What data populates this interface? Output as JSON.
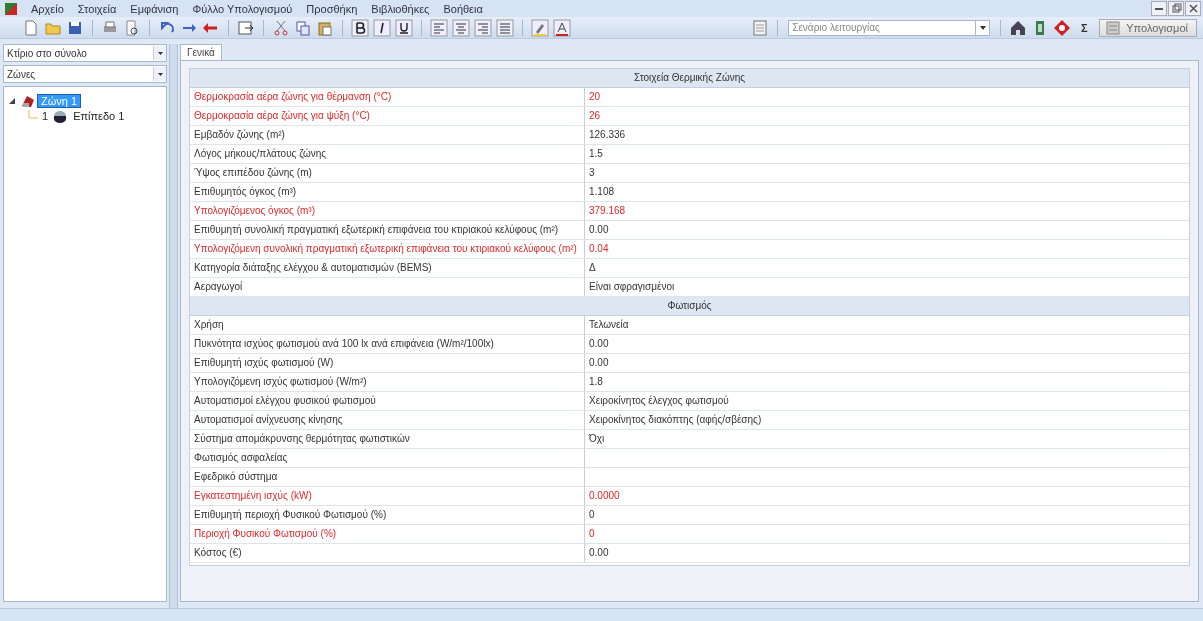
{
  "menu": [
    "Αρχείο",
    "Στοιχεία",
    "Εμφάνιση",
    "Φύλλο Υπολογισμού",
    "Προσθήκη",
    "Βιβλιοθήκες",
    "Βοήθεια"
  ],
  "toolbar": {
    "scenario": {
      "placeholder": "Σενάριο λειτουργίας"
    },
    "sum_symbol": "Σ",
    "calculate": "Υπολογισμοί"
  },
  "sidebar": {
    "building_select": "Κτίριο στο σύνολο",
    "zone_select": "Ζώνες",
    "tree": [
      {
        "label": "Ζώνη 1",
        "selected": true,
        "expanded": true,
        "children": [
          {
            "number": "1",
            "label": "Επίπεδο 1",
            "selected": false
          }
        ]
      }
    ]
  },
  "tabs": [
    {
      "label": "Γενικά",
      "selected": true
    }
  ],
  "sections": [
    {
      "title": "Στοιχεία Θερμικής Ζώνης",
      "rows": [
        {
          "label": "Θερμοκρασία αέρα ζώνης για θέρμανση (°C)",
          "value": "20",
          "highlighted": true
        },
        {
          "label": "Θερμοκρασία αέρα ζώνης για ψύξη (°C)",
          "value": "26",
          "highlighted": true
        },
        {
          "label": "Εμβαδόν ζώνης (m²)",
          "value": "126.336",
          "highlighted": false
        },
        {
          "label": "Λόγος μήκους/πλάτους ζώνης",
          "value": "1.5",
          "highlighted": false
        },
        {
          "label": "Ύψος επιπέδου ζώνης (m)",
          "value": "3",
          "highlighted": false
        },
        {
          "label": "Επιθυμητός όγκος (m³)",
          "value": "1.108",
          "highlighted": false
        },
        {
          "label": "Υπολογιζόμενος όγκος (m³)",
          "value": "379.168",
          "highlighted": true
        },
        {
          "label": "Επιθυμητή συνολική πραγματική εξωτερική επιφάνεια του κτιριακού κελύφους (m²)",
          "value": "0.00",
          "highlighted": false
        },
        {
          "label": "Υπολογιζόμενη συνολική πραγματική εξωτερική επιφάνεια του κτιριακού κελύφους (m²)",
          "value": "0.04",
          "highlighted": true
        },
        {
          "label": "Κατηγορία διάταξης ελέγχου & αυτοματισμών (BEMS)",
          "value": "Δ",
          "highlighted": false
        },
        {
          "label": "Αεραγωγοί",
          "value": "Είναι σφραγισμένοι",
          "highlighted": false
        }
      ]
    },
    {
      "title": "Φωτισμός",
      "rows": [
        {
          "label": "Χρήση",
          "value": "Τελωνεία",
          "highlighted": false
        },
        {
          "label": "Πυκνότητα ισχύος φωτισμού ανά 100 lx ανά επιφάνεια (W/m²/100lx)",
          "value": "0.00",
          "highlighted": false
        },
        {
          "label": "Επιθυμητή ισχύς φωτισμού (W)",
          "value": "0.00",
          "highlighted": false
        },
        {
          "label": "Υπολογιζόμενη ισχύς φωτισμού (W/m²)",
          "value": "1.8",
          "highlighted": false
        },
        {
          "label": "Αυτοματισμοί ελέγχου φυσικού φωτισμού",
          "value": "Χειροκίνητος έλεγχος φωτισμού",
          "highlighted": false
        },
        {
          "label": "Αυτοματισμοί ανίχνευσης κίνησης",
          "value": "Χειροκίνητος διακόπτης (αφής/σβέσης)",
          "highlighted": false
        },
        {
          "label": "Σύστημα απομάκρυνσης θερμότητας φωτιστικών",
          "value": "Όχι",
          "highlighted": false
        },
        {
          "label": "Φωτισμός ασφαλείας",
          "highlighted": false
        },
        {
          "label": "Εφεδρικό σύστημα",
          "highlighted": false
        },
        {
          "label": "Εγκατεστημένη ισχύς (kW)",
          "value": "0.0000",
          "highlighted": true
        },
        {
          "label": "Επιθυμητή περιοχή Φυσικού Φωτισμού (%)",
          "value": "0",
          "highlighted": false
        },
        {
          "label": "Περιοχή Φυσικού Φωτισμού (%)",
          "value": "0",
          "highlighted": true
        },
        {
          "label": "Κόστος (€)",
          "value": "0.00",
          "highlighted": false
        }
      ]
    }
  ]
}
